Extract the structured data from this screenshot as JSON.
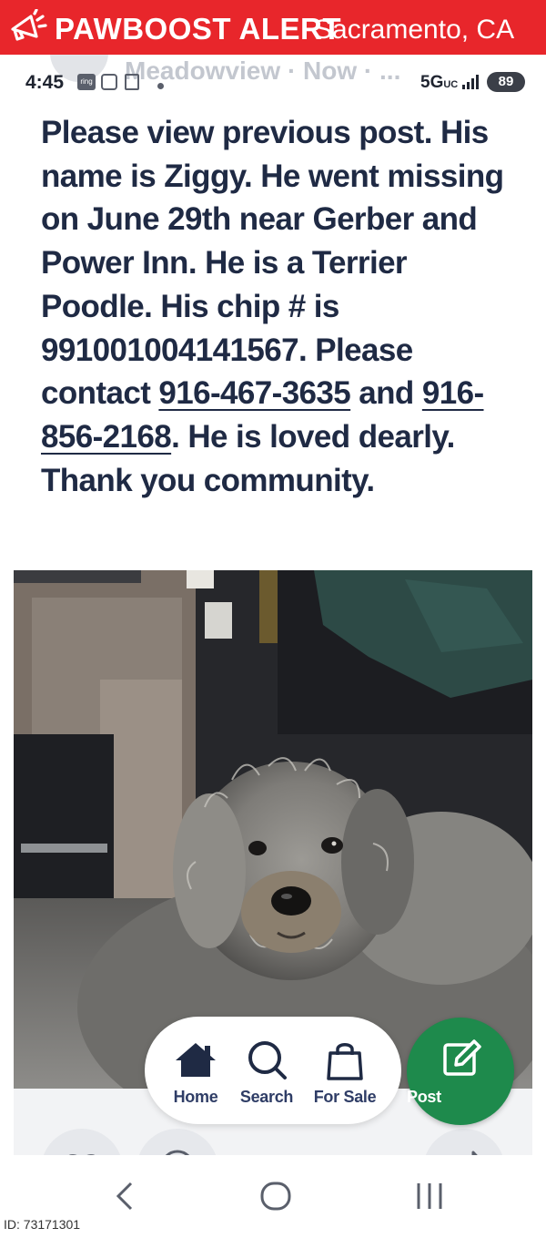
{
  "banner": {
    "brand": "PAWBOOST ALERT",
    "city": "Sacramento, CA",
    "color": "#e8262b",
    "icon": "megaphone-icon"
  },
  "status_bar": {
    "time": "4:45",
    "header_meta": "Meadowview · Now · ...",
    "network": "5G",
    "network_suffix": "UC",
    "battery": "89",
    "ring_label": "ring"
  },
  "post": {
    "text_1": "Please view previous post. His name is Ziggy. He went missing on June 29th near Gerber and Power Inn.  He is a Terrier Poodle. His chip # is 991001004141567. Please contact ",
    "phone_1": "916-467-3635",
    "text_2": " and ",
    "phone_2": "916-856-2168",
    "text_3": ". He is loved dearly. Thank you community."
  },
  "bottom_nav": {
    "items": [
      {
        "label": "Home",
        "icon": "home-icon"
      },
      {
        "label": "Search",
        "icon": "search-icon"
      },
      {
        "label": "For Sale",
        "icon": "shopping-bag-icon"
      }
    ],
    "post_label": "Post",
    "post_icon": "edit-icon",
    "post_color": "#1e8a4c",
    "nav_text_color": "#2f3d66"
  },
  "footer": {
    "id_label": "ID: 73171301"
  }
}
